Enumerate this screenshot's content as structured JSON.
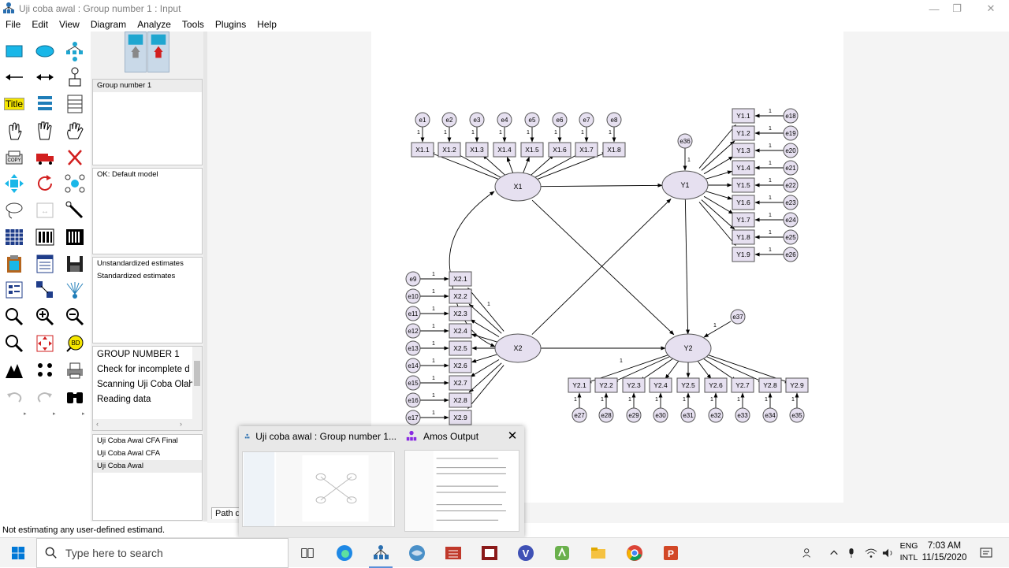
{
  "window": {
    "title": "Uji coba awal : Group number 1 : Input",
    "minimize": "—",
    "restore": "❐",
    "close": "✕"
  },
  "menu": [
    "File",
    "Edit",
    "View",
    "Diagram",
    "Analyze",
    "Tools",
    "Plugins",
    "Help"
  ],
  "toolbox": {
    "title_tool": "Title"
  },
  "panels": {
    "groups": [
      "Group number 1"
    ],
    "models": [
      "OK: Default model"
    ],
    "estimates": [
      "Unstandardized estimates",
      "Standardized estimates"
    ],
    "log": [
      "GROUP NUMBER 1",
      "Check for incomplete d",
      "Scanning Uji Coba Olah",
      "Reading data"
    ],
    "files": [
      "Uji Coba Awal CFA Final",
      "Uji Coba Awal CFA",
      "Uji Coba Awal"
    ],
    "selected_file": "Uji Coba Awal"
  },
  "path_diagram_tab": "Path di",
  "diagram": {
    "latents": [
      {
        "label": "X1"
      },
      {
        "label": "Y1"
      },
      {
        "label": "X2"
      },
      {
        "label": "Y2"
      }
    ],
    "x1_items": [
      "X1.1",
      "X1.2",
      "X1.3",
      "X1.4",
      "X1.5",
      "X1.6",
      "X1.7",
      "X1.8"
    ],
    "x1_errors": [
      "e1",
      "e2",
      "e3",
      "e4",
      "e5",
      "e6",
      "e7",
      "e8"
    ],
    "x2_items": [
      "X2.1",
      "X2.2",
      "X2.3",
      "X2.4",
      "X2.5",
      "X2.6",
      "X2.7",
      "X2.8",
      "X2.9"
    ],
    "x2_errors": [
      "e9",
      "e10",
      "e11",
      "e12",
      "e13",
      "e14",
      "e15",
      "e16",
      "e17"
    ],
    "y1_items": [
      "Y1.1",
      "Y1.2",
      "Y1.3",
      "Y1.4",
      "Y1.5",
      "Y1.6",
      "Y1.7",
      "Y1.8",
      "Y1.9"
    ],
    "y1_errors": [
      "e18",
      "e19",
      "e20",
      "e21",
      "e22",
      "e23",
      "e24",
      "e25",
      "e26"
    ],
    "y2_items": [
      "Y2.1",
      "Y2.2",
      "Y2.3",
      "Y2.4",
      "Y2.5",
      "Y2.6",
      "Y2.7",
      "Y2.8",
      "Y2.9"
    ],
    "y2_errors": [
      "e27",
      "e28",
      "e29",
      "e30",
      "e31",
      "e32",
      "e33",
      "e34",
      "e35"
    ],
    "disturbances": [
      "e36",
      "e37"
    ],
    "weight_label": "1"
  },
  "status": "Not estimating any user-defined estimand.",
  "preview": {
    "card1_title": "Uji coba awal : Group number 1...",
    "card2_title": "Amos Output",
    "close": "✕"
  },
  "taskbar": {
    "search_placeholder": "Type here to search",
    "lang_top": "ENG",
    "lang_bottom": "INTL",
    "time": "7:03 AM",
    "date": "11/15/2020"
  },
  "colors": {
    "node_fill": "#e6e0f0",
    "node_stroke": "#555555",
    "accent": "#5a8fd8"
  }
}
